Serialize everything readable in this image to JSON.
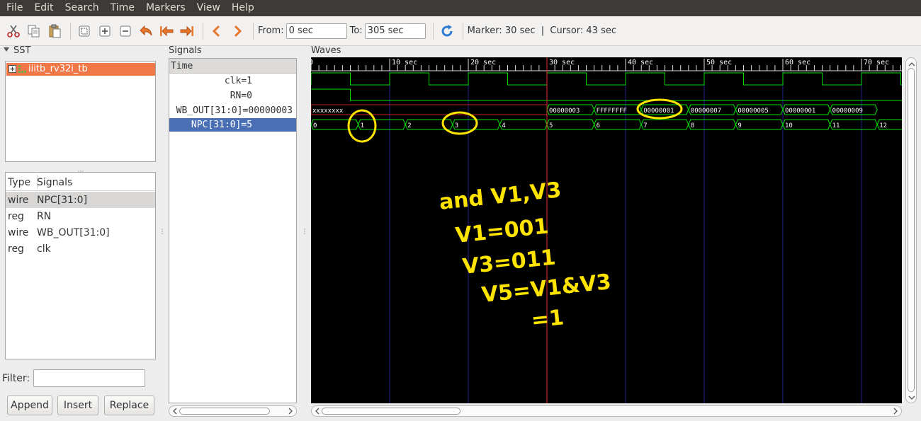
{
  "menu": [
    "File",
    "Edit",
    "Search",
    "Time",
    "Markers",
    "View",
    "Help"
  ],
  "toolbar": {
    "icons": [
      "cut-icon",
      "copy-icon",
      "paste-icon",
      "zoom-fit-icon",
      "zoom-in-icon",
      "zoom-out-icon",
      "undo-zoom-icon",
      "zoom-to-start-icon",
      "zoom-to-end-icon",
      "prev-edge-icon",
      "next-edge-icon"
    ],
    "from_label": "From:",
    "from_value": "0 sec",
    "to_label": "To:",
    "to_value": "305 sec",
    "reload_icon": "reload-icon",
    "marker_text": "Marker: 30 sec  |  Cursor: 43 sec"
  },
  "sst": {
    "title": "SST",
    "tree_item": "iiitb_rv32i_tb",
    "table_headers": [
      "Type",
      "Signals"
    ],
    "rows": [
      {
        "type": "wire",
        "signal": "NPC[31:0]"
      },
      {
        "type": "reg",
        "signal": "RN"
      },
      {
        "type": "wire",
        "signal": "WB_OUT[31:0]"
      },
      {
        "type": "reg",
        "signal": "clk"
      }
    ],
    "filter_label": "Filter:",
    "filter_value": "",
    "buttons": [
      "Append",
      "Insert",
      "Replace"
    ]
  },
  "signals": {
    "title": "Signals",
    "header": "Time",
    "rows": [
      "clk=1",
      "RN=0",
      "WB_OUT[31:0]=00000003",
      "NPC[31:0]=5"
    ]
  },
  "waves": {
    "title": "Waves",
    "ruler_labels": [
      "0",
      "10 sec",
      "20 sec",
      "30 sec",
      "40 sec",
      "50 sec",
      "60 sec",
      "70 sec"
    ],
    "wb_out_values": [
      "xxxxxxxx",
      "00000003",
      "FFFFFFFF",
      "00000001",
      "00000007",
      "00000005",
      "00000001",
      "00000009"
    ],
    "npc_values": [
      "0",
      "1",
      "2",
      "3",
      "4",
      "5",
      "6",
      "7",
      "8",
      "9",
      "10",
      "11",
      "12"
    ],
    "handwriting": [
      "and V1,V3",
      "V1=001",
      "V3=011",
      "V5=V1&V3",
      "=1"
    ]
  },
  "colors": {
    "wave_green": "#00e000",
    "marker_red": "#e03030",
    "grid_blue": "#23238e",
    "annotation_yellow": "#ffe400",
    "selection_blue": "#4a6fb5",
    "tree_selection": "#f07746"
  }
}
